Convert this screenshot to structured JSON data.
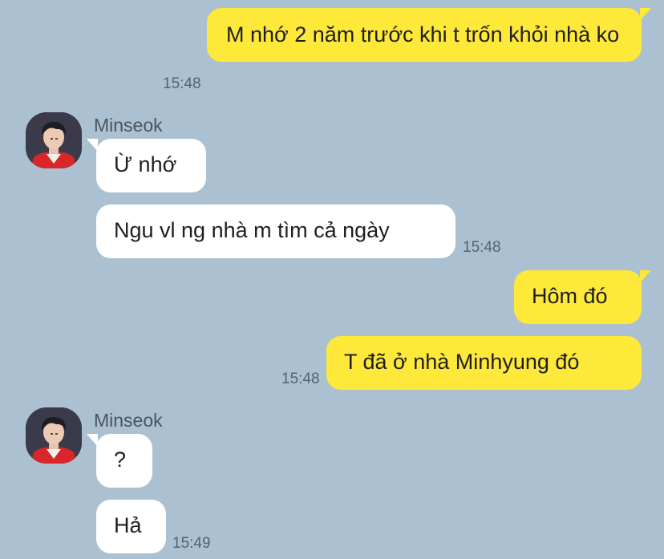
{
  "colors": {
    "background": "#abc1d1",
    "outgoing_bubble": "#fee83a",
    "incoming_bubble": "#ffffff"
  },
  "messages": [
    {
      "direction": "out",
      "text": "M nhớ 2 năm trước khi t trốn khỏi nhà ko",
      "time": "15:48"
    },
    {
      "direction": "in",
      "sender": "Minseok",
      "text": "Ừ nhớ"
    },
    {
      "direction": "in",
      "text": "Ngu vl ng nhà m tìm cả ngày",
      "time": "15:48"
    },
    {
      "direction": "out",
      "text": "Hôm đó"
    },
    {
      "direction": "out",
      "text": "T đã ở nhà Minhyung đó",
      "time": "15:48"
    },
    {
      "direction": "in",
      "sender": "Minseok",
      "text": "?"
    },
    {
      "direction": "in",
      "text": "Hả",
      "time": "15:49"
    }
  ],
  "avatar_icon": "profile-photo"
}
